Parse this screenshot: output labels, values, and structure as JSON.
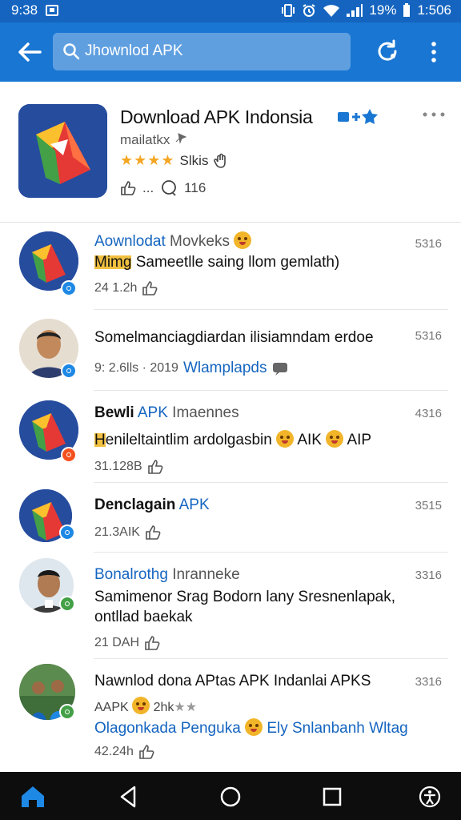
{
  "status": {
    "time": "9:38",
    "battery": "19%",
    "clock": "1:506"
  },
  "search": {
    "query": "Jhownlod APK"
  },
  "app": {
    "title": "Download APK Indonsia",
    "subtitle": "mailatkx",
    "rating_text": "Slkis",
    "stars": "★★★★",
    "comments": "116",
    "likes": "..."
  },
  "posts": [
    {
      "title_blue": "Aownlodat",
      "title_grey": "Movkeks",
      "time": "5316",
      "text_hl": "Mimg",
      "text": "Sameetlle saing llom gemlath)",
      "meta": "24 1.2h"
    },
    {
      "title": "Somelmanciagdiardan ilisiamndam erdoe",
      "time": "5316",
      "meta": "9: 2.6lls · 2019",
      "link": "Wlamplapds"
    },
    {
      "title": "Bewli",
      "title_blue": "APK",
      "title_grey": "Imaennes",
      "time": "4316",
      "text_hl": "H",
      "text": "enileltaintlim ardolgasbin",
      "text2": "AIK",
      "text3": "AIP",
      "meta": "31.128B"
    },
    {
      "title": "Denclagain",
      "title_blue": "APK",
      "time": "3515",
      "meta": "21.3AIK"
    },
    {
      "title_blue": "Bonalrothg",
      "title_grey": "Inranneke",
      "time": "3316",
      "text": "Samimenor Srag Bodorn lany Sresnenlapak,",
      "text_line2": "ontllad baekak",
      "meta": "21 DAH"
    },
    {
      "title": "Nawnlod dona APtas APK Indanlai APKS",
      "time": "3316",
      "sub": "AAPK",
      "sub2": "2hk",
      "sub_stars": "★★",
      "link": "Olagonkada Penguka",
      "link2": "Ely Snlanbanh Wltag",
      "meta": "42.24h"
    }
  ],
  "colors": {
    "appbar": "#1976d2",
    "statusbar": "#1565c0",
    "accent": "#1565c0",
    "star": "#f5a623"
  }
}
